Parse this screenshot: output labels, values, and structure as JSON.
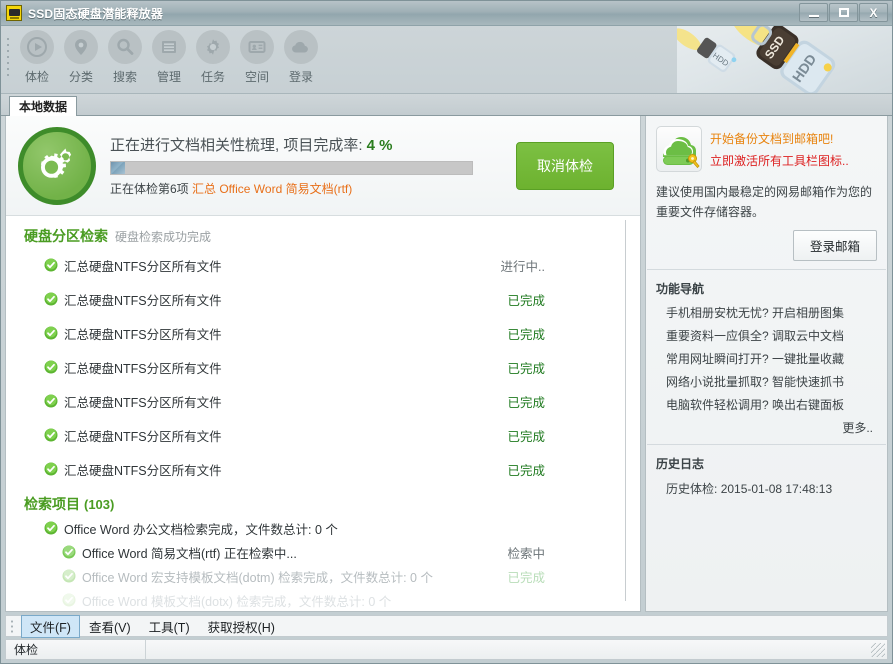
{
  "window": {
    "title": "SSD固态硬盘潜能释放器",
    "app_icon": "ssd-app-icon",
    "buttons": {
      "minimize": "–",
      "maximize": "□",
      "close": "X"
    }
  },
  "toolbar": {
    "items": [
      {
        "label": "体检",
        "icon": "play-circle-icon"
      },
      {
        "label": "分类",
        "icon": "location-pin-icon"
      },
      {
        "label": "搜索",
        "icon": "search-icon"
      },
      {
        "label": "管理",
        "icon": "list-icon"
      },
      {
        "label": "任务",
        "icon": "gear-icon"
      },
      {
        "label": "空间",
        "icon": "id-card-icon"
      },
      {
        "label": "登录",
        "icon": "cloud-icon"
      }
    ]
  },
  "tabs": [
    {
      "label": "本地数据",
      "active": true
    }
  ],
  "scan": {
    "logo_icon": "gears-circle-icon",
    "title_prefix": "正在进行文档相关性梳理, 项目完成率: ",
    "percent_text": "4 %",
    "percent_value": 4,
    "sub_prefix": "正在体检第6项 ",
    "sub_target": "汇总 Office Word 简易文档(rtf)",
    "cancel_label": "取消体检"
  },
  "partition_section": {
    "title": "硬盘分区检索",
    "note": "硬盘检索成功完成",
    "rows": [
      {
        "label": "汇总硬盘NTFS分区所有文件",
        "status": "进行中..",
        "state": "running"
      },
      {
        "label": "汇总硬盘NTFS分区所有文件",
        "status": "已完成",
        "state": "done"
      },
      {
        "label": "汇总硬盘NTFS分区所有文件",
        "status": "已完成",
        "state": "done"
      },
      {
        "label": "汇总硬盘NTFS分区所有文件",
        "status": "已完成",
        "state": "done"
      },
      {
        "label": "汇总硬盘NTFS分区所有文件",
        "status": "已完成",
        "state": "done"
      },
      {
        "label": "汇总硬盘NTFS分区所有文件",
        "status": "已完成",
        "state": "done"
      },
      {
        "label": "汇总硬盘NTFS分区所有文件",
        "status": "已完成",
        "state": "done"
      }
    ]
  },
  "retrieval_section": {
    "title": "检索项目",
    "count": "(103)",
    "rows": [
      {
        "label": "Office Word 办公文档检索完成，文件数总计: 0 个",
        "status": "",
        "level": 1,
        "fade": "none"
      },
      {
        "label": "Office Word 简易文档(rtf) 正在检索中...",
        "status": "检索中",
        "level": 2,
        "fade": "none"
      },
      {
        "label": "Office Word 宏支持模板文档(dotm) 检索完成，文件数总计: 0 个",
        "status": "已完成",
        "level": 2,
        "fade": "faded"
      },
      {
        "label": "Office Word 模板文档(dotx) 检索完成，文件数总计: 0 个",
        "status": "",
        "level": 2,
        "fade": "faded2"
      }
    ]
  },
  "sidebar": {
    "promo": {
      "icon": "cloud-drive-key-icon",
      "line1": "开始备份文档到邮箱吧!",
      "line2": "立即激活所有工具栏图标..",
      "description": "建议使用国内最稳定的网易邮箱作为您的重要文件存储容器。",
      "button_label": "登录邮箱"
    },
    "nav": {
      "title": "功能导航",
      "items": [
        "手机相册安枕无忧? 开启相册图集",
        "重要资料一应俱全? 调取云中文档",
        "常用网址瞬间打开? 一键批量收藏",
        "网络小说批量抓取? 智能快速抓书",
        "电脑软件轻松调用? 唤出右键面板"
      ],
      "more_label": "更多.."
    },
    "history": {
      "title": "历史日志",
      "entry_label": "历史体检:",
      "entry_value": "2015-01-08 17:48:13"
    }
  },
  "menubar": {
    "items": [
      {
        "label": "文件(F)",
        "active": true
      },
      {
        "label": "查看(V)",
        "active": false
      },
      {
        "label": "工具(T)",
        "active": false
      },
      {
        "label": "获取授权(H)",
        "active": false
      }
    ]
  },
  "statusbar": {
    "left": "体检",
    "right": ""
  },
  "colors": {
    "accent_green": "#4a9c22",
    "button_green": "#6db22f",
    "done_green": "#1f7a1f",
    "orange": "#e8840f",
    "red": "#dd2020",
    "link_orange": "#e8701a",
    "progress_blue": "#7da3bb"
  }
}
